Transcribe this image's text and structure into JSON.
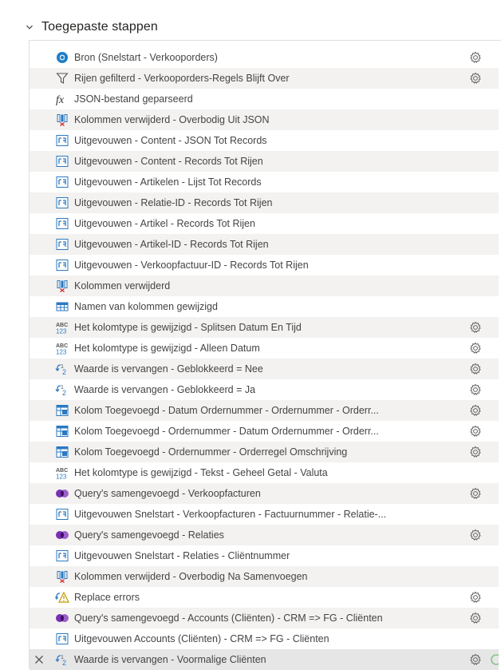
{
  "header": {
    "title": "Toegepaste stappen",
    "chevron_icon": "chevron-down-icon"
  },
  "colors": {
    "text": "#444444",
    "gear": "#605e5c",
    "blue_icon": "#2b79c2",
    "purple_icon": "#7b2fb5",
    "selected_row": "#e6e6e6"
  },
  "steps": [
    {
      "label": "Bron (Snelstart - Verkooporders)",
      "icon": "source-icon",
      "gear": true
    },
    {
      "label": "Rijen gefilterd - Verkooporders-Regels Blijft Over",
      "icon": "filter-icon",
      "gear": true
    },
    {
      "label": "JSON-bestand geparseerd",
      "icon": "function-icon",
      "gear": false
    },
    {
      "label": "Kolommen verwijderd - Overbodig Uit JSON",
      "icon": "remove-columns-icon",
      "gear": false
    },
    {
      "label": "Uitgevouwen - Content - JSON Tot Records",
      "icon": "expand-icon",
      "gear": false
    },
    {
      "label": "Uitgevouwen - Content - Records Tot Rijen",
      "icon": "expand-icon",
      "gear": false
    },
    {
      "label": "Uitgevouwen - Artikelen - Lijst Tot Records",
      "icon": "expand-icon",
      "gear": false
    },
    {
      "label": "Uitgevouwen - Relatie-ID - Records Tot Rijen",
      "icon": "expand-icon",
      "gear": false
    },
    {
      "label": "Uitgevouwen - Artikel - Records Tot Rijen",
      "icon": "expand-icon",
      "gear": false
    },
    {
      "label": "Uitgevouwen - Artikel-ID - Records Tot Rijen",
      "icon": "expand-icon",
      "gear": false
    },
    {
      "label": "Uitgevouwen - Verkoopfactuur-ID - Records Tot Rijen",
      "icon": "expand-icon",
      "gear": false
    },
    {
      "label": "Kolommen verwijderd",
      "icon": "remove-columns-icon",
      "gear": false
    },
    {
      "label": "Namen van kolommen gewijzigd",
      "icon": "rename-columns-icon",
      "gear": false
    },
    {
      "label": "Het kolomtype is gewijzigd - Splitsen Datum En Tijd",
      "icon": "change-type-icon",
      "gear": true
    },
    {
      "label": "Het kolomtype is gewijzigd - Alleen Datum",
      "icon": "change-type-icon",
      "gear": true
    },
    {
      "label": "Waarde is vervangen - Geblokkeerd = Nee",
      "icon": "replace-values-icon",
      "gear": true
    },
    {
      "label": "Waarde is vervangen - Geblokkeerd = Ja",
      "icon": "replace-values-icon",
      "gear": true
    },
    {
      "label": "Kolom Toegevoegd - Datum Ordernummer - Ordernummer - Orderr...",
      "icon": "add-column-icon",
      "gear": true
    },
    {
      "label": "Kolom Toegevoegd - Ordernummer - Datum Ordernummer - Orderr...",
      "icon": "add-column-icon",
      "gear": true
    },
    {
      "label": "Kolom Toegevoegd - Ordernummer - Orderregel Omschrijving",
      "icon": "add-column-icon",
      "gear": true
    },
    {
      "label": "Het kolomtype is gewijzigd - Tekst - Geheel Getal - Valuta",
      "icon": "change-type-icon",
      "gear": false
    },
    {
      "label": "Query's samengevoegd - Verkoopfacturen",
      "icon": "merge-queries-icon",
      "gear": true
    },
    {
      "label": "Uitgevouwen Snelstart - Verkoopfacturen - Factuurnummer - Relatie-...",
      "icon": "expand-icon",
      "gear": false
    },
    {
      "label": "Query's samengevoegd - Relaties",
      "icon": "merge-queries-icon",
      "gear": true
    },
    {
      "label": "Uitgevouwen Snelstart - Relaties - Cliëntnummer",
      "icon": "expand-icon",
      "gear": false
    },
    {
      "label": "Kolommen verwijderd - Overbodig Na Samenvoegen",
      "icon": "remove-columns-icon",
      "gear": false
    },
    {
      "label": "Replace errors",
      "icon": "replace-errors-icon",
      "gear": true
    },
    {
      "label": "Query's samengevoegd - Accounts (Cliënten) - CRM => FG - Cliënten",
      "icon": "merge-queries-icon",
      "gear": true
    },
    {
      "label": "Uitgevouwen Accounts (Cliënten) - CRM => FG - Cliënten",
      "icon": "expand-icon",
      "gear": false
    },
    {
      "label": "Waarde is vervangen - Voormalige Cliënten",
      "icon": "replace-values-icon",
      "gear": true,
      "selected": true
    }
  ]
}
